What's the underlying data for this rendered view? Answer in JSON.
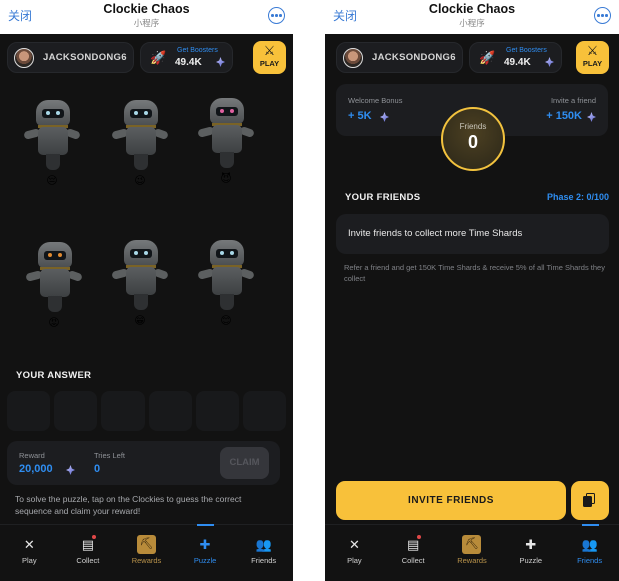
{
  "app": {
    "close_label": "关闭",
    "title": "Clockie Chaos",
    "subtitle": "小程序",
    "more_icon": "more-dots-icon"
  },
  "topbar": {
    "username": "JACKSONDONG6",
    "boosters_label": "Get Boosters",
    "boosters_value": "49.4K",
    "play_label": "PLAY",
    "play_icon": "⚔"
  },
  "puzzle_screen": {
    "clockies": [
      {
        "emoji": "😔",
        "mood": "pensive",
        "eye_color": "#a8d8e8"
      },
      {
        "emoji": "😉",
        "mood": "wink",
        "eye_color": "#a8d8e8"
      },
      {
        "emoji": "😈",
        "mood": "devil",
        "eye_color": "#e060a0"
      },
      {
        "emoji": "😡",
        "mood": "angry",
        "eye_color": "#e08a30"
      },
      {
        "emoji": "😁",
        "mood": "grin",
        "eye_color": "#a8d8e8"
      },
      {
        "emoji": "😊",
        "mood": "smile",
        "eye_color": "#a8d8e8"
      }
    ],
    "answer_title": "YOUR ANSWER",
    "answer_slots": 6,
    "reward_label": "Reward",
    "reward_value": "20,000",
    "tries_label": "Tries Left",
    "tries_value": "0",
    "claim_label": "CLAIM",
    "hint": "To solve the puzzle, tap on the Clockies to guess the correct sequence and claim your reward!"
  },
  "friends_screen": {
    "welcome_label": "Welcome Bonus",
    "welcome_value": "+ 5K",
    "invite_label": "Invite a friend",
    "invite_value": "+ 150K",
    "friends_label": "Friends",
    "friends_count": "0",
    "section_title": "YOUR FRIENDS",
    "phase": "Phase 2: 0/100",
    "empty_message": "Invite friends to collect more Time Shards",
    "refer_text": "Refer a friend and get 150K Time Shards & receive 5% of all Time Shards they collect",
    "invite_button": "INVITE FRIENDS",
    "copy_icon": "copy-icon"
  },
  "nav": {
    "items": [
      {
        "label": "Play",
        "icon": "✕"
      },
      {
        "label": "Collect",
        "icon": "▤"
      },
      {
        "label": "Rewards",
        "icon": "⛏"
      },
      {
        "label": "Puzzle",
        "icon": "✚"
      },
      {
        "label": "Friends",
        "icon": "👥"
      }
    ],
    "left_active": "Puzzle",
    "right_active": "Friends"
  },
  "colors": {
    "accent_blue": "#2f8df0",
    "accent_yellow": "#f8c13a",
    "background": "#121212",
    "card": "#1c1d20"
  }
}
